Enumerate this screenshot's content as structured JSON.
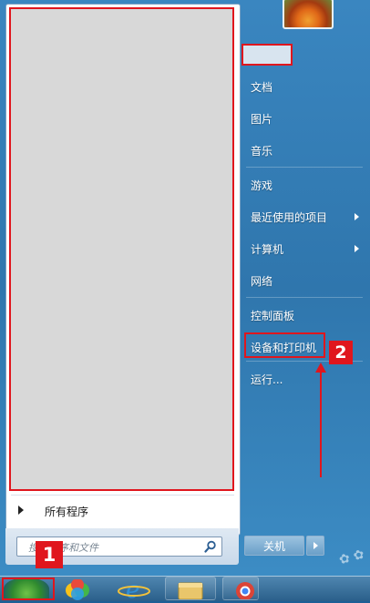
{
  "start_menu": {
    "all_programs": "所有程序",
    "search_placeholder": "搜索程序和文件",
    "right_items": [
      {
        "label": "文档",
        "submenu": false
      },
      {
        "label": "图片",
        "submenu": false
      },
      {
        "label": "音乐",
        "submenu": false
      },
      {
        "label": "游戏",
        "submenu": false
      },
      {
        "label": "最近使用的项目",
        "submenu": true
      },
      {
        "label": "计算机",
        "submenu": true
      },
      {
        "label": "网络",
        "submenu": false
      },
      {
        "label": "控制面板",
        "submenu": false
      },
      {
        "label": "设备和打印机",
        "submenu": false
      },
      {
        "label": "运行...",
        "submenu": false
      }
    ],
    "shutdown_label": "关机"
  },
  "annotations": {
    "step1": "1",
    "step2": "2"
  },
  "taskbar": {
    "pinned": [
      "start-orb",
      "game-icon",
      "ie-icon",
      "explorer-icon",
      "chrome-icon"
    ]
  },
  "colors": {
    "highlight": "#e0161d",
    "menu_blue": "#2f76ad"
  }
}
